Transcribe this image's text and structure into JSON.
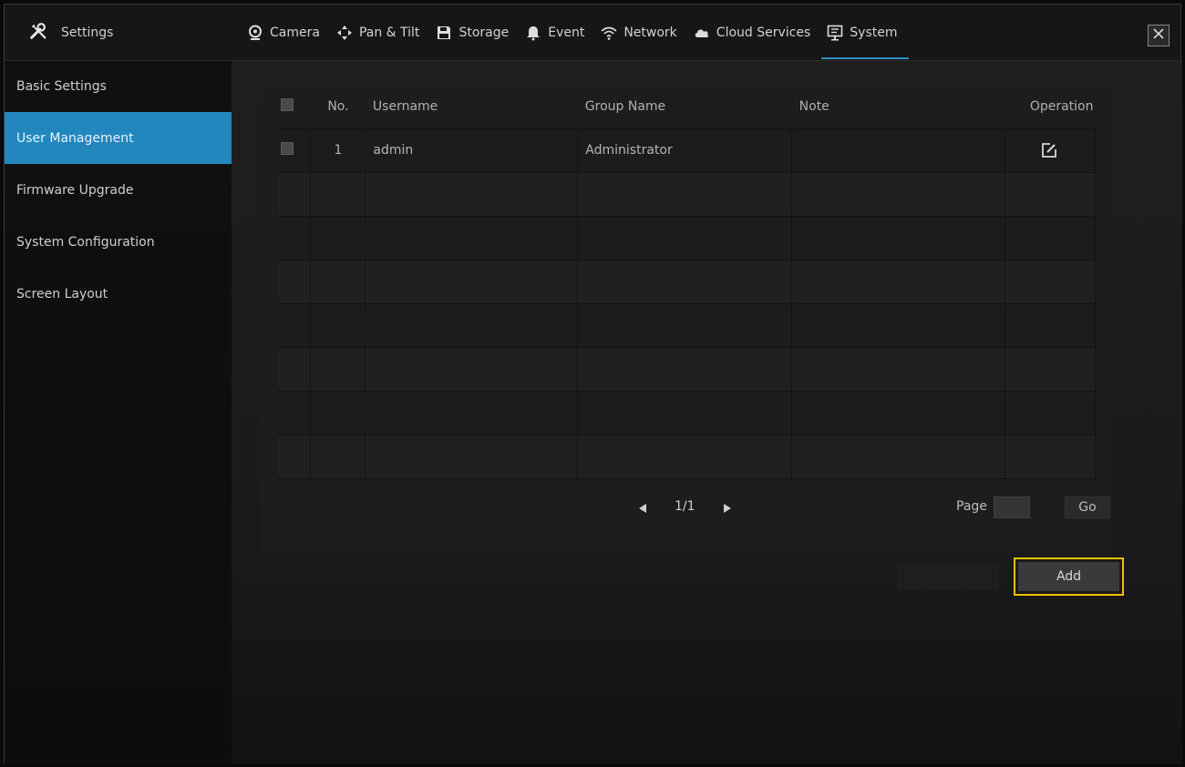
{
  "header": {
    "app_title": "Settings",
    "tabs": [
      {
        "label": "Camera",
        "icon": "camera-icon"
      },
      {
        "label": "Pan & Tilt",
        "icon": "pan-tilt-icon"
      },
      {
        "label": "Storage",
        "icon": "storage-icon"
      },
      {
        "label": "Event",
        "icon": "bell-icon"
      },
      {
        "label": "Network",
        "icon": "wifi-icon"
      },
      {
        "label": "Cloud Services",
        "icon": "cloud-icon"
      },
      {
        "label": "System",
        "icon": "monitor-icon",
        "active": true
      }
    ]
  },
  "sidebar": {
    "items": [
      {
        "label": "Basic Settings"
      },
      {
        "label": "User Management",
        "active": true
      },
      {
        "label": "Firmware Upgrade"
      },
      {
        "label": "System Configuration"
      },
      {
        "label": "Screen Layout"
      }
    ]
  },
  "table": {
    "columns": {
      "no": "No.",
      "username": "Username",
      "group": "Group Name",
      "note": "Note",
      "operation": "Operation"
    },
    "rows": [
      {
        "no": "1",
        "username": "admin",
        "group": "Administrator",
        "note": ""
      }
    ]
  },
  "pager": {
    "current": "1/1",
    "page_label": "Page",
    "go_label": "Go"
  },
  "actions": {
    "add_label": "Add"
  },
  "colors": {
    "accent": "#2187bd",
    "highlight": "#f0c000"
  }
}
